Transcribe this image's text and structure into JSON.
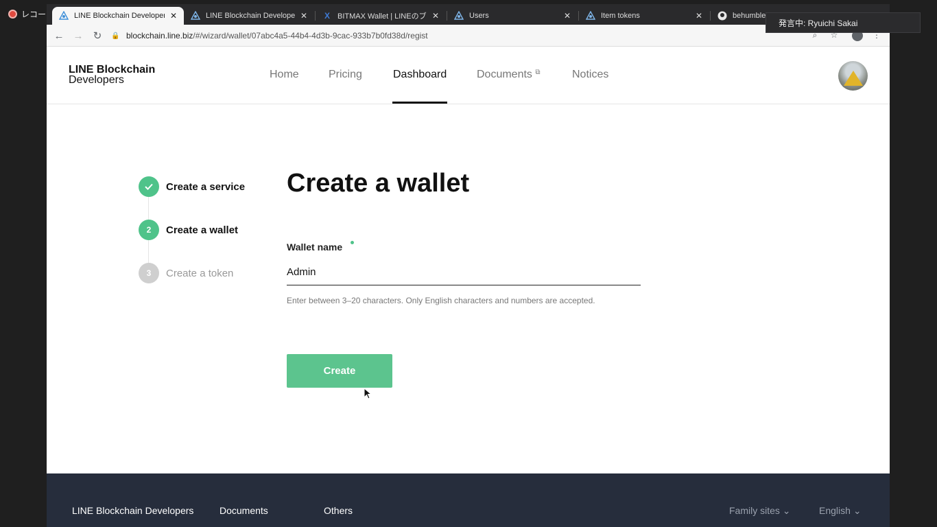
{
  "desktop": {
    "recording_label": "レコーデ"
  },
  "browser": {
    "tabs": [
      {
        "label": "LINE Blockchain Developers",
        "icon": "line-blockchain-icon",
        "active": true
      },
      {
        "label": "LINE Blockchain Developers",
        "icon": "line-blockchain-icon",
        "active": false
      },
      {
        "label": "BITMAX Wallet | LINEのブロ",
        "icon": "bitmax-icon",
        "active": false
      },
      {
        "label": "Users",
        "icon": "line-blockchain-icon",
        "active": false
      },
      {
        "label": "Item tokens",
        "icon": "line-blockchain-icon",
        "active": false
      },
      {
        "label": "behumble/",
        "icon": "github-icon",
        "active": false
      }
    ],
    "url_host": "blockchain.line.biz",
    "url_path": "/#/wizard/wallet/07abc4a5-44b4-4d3b-9cac-933b7b0fd38d/regist"
  },
  "header": {
    "logo_line1": "LINE Blockchain",
    "logo_line2": "Developers",
    "nav": [
      {
        "label": "Home",
        "active": false
      },
      {
        "label": "Pricing",
        "active": false
      },
      {
        "label": "Dashboard",
        "active": true
      },
      {
        "label": "Documents",
        "active": false
      },
      {
        "label": "Notices",
        "active": false
      }
    ]
  },
  "wizard": {
    "steps": [
      {
        "number": "",
        "label": "Create a service",
        "state": "done"
      },
      {
        "number": "2",
        "label": "Create a wallet",
        "state": "current"
      },
      {
        "number": "3",
        "label": "Create a token",
        "state": "todo"
      }
    ],
    "title": "Create a wallet",
    "field_label": "Wallet name",
    "field_value": "Admin",
    "hint": "Enter between 3–20 characters. Only English characters and numbers are accepted.",
    "create_button": "Create"
  },
  "footer": {
    "col1": "LINE Blockchain Developers",
    "col2": "Documents",
    "col3": "Others",
    "family_sites": "Family sites",
    "language": "English"
  },
  "overlay": {
    "speaker": "発言中: Ryuichi Sakai"
  },
  "colors": {
    "accent_green": "#4fc38a",
    "footer_bg": "#262d3c"
  }
}
